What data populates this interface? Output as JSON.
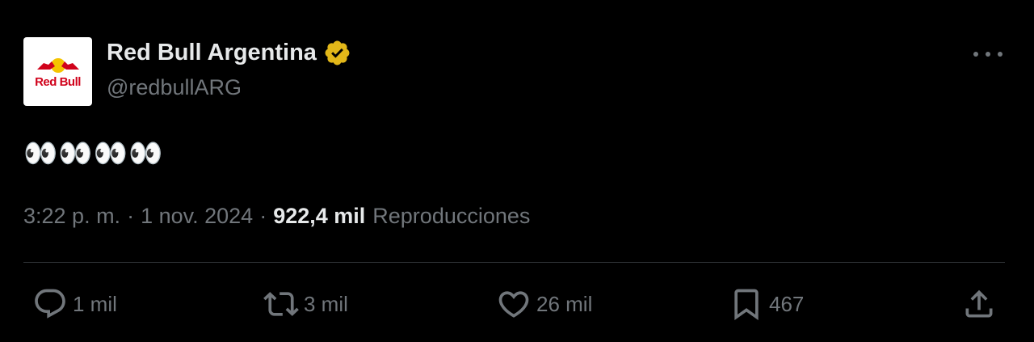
{
  "author": {
    "display_name": "Red Bull Argentina",
    "handle": "@redbullARG",
    "avatar_text": "Red Bull",
    "verified_color": "#e2b719"
  },
  "tweet": {
    "text": "👀👀👀👀"
  },
  "meta": {
    "time": "3:22 p. m.",
    "separator_1": "·",
    "date": "1 nov. 2024",
    "separator_2": "·",
    "views_count": "922,4 mil",
    "views_label": "Reproducciones"
  },
  "actions": {
    "reply_count": "1 mil",
    "retweet_count": "3 mil",
    "like_count": "26 mil",
    "bookmark_count": "467"
  },
  "icons": {
    "reply": "reply-icon",
    "retweet": "retweet-icon",
    "like": "heart-icon",
    "bookmark": "bookmark-icon",
    "share": "share-icon",
    "more": "more-icon"
  },
  "colors": {
    "background": "#000000",
    "text_primary": "#e7e9ea",
    "text_secondary": "#71767b",
    "divider": "#2f3336"
  }
}
